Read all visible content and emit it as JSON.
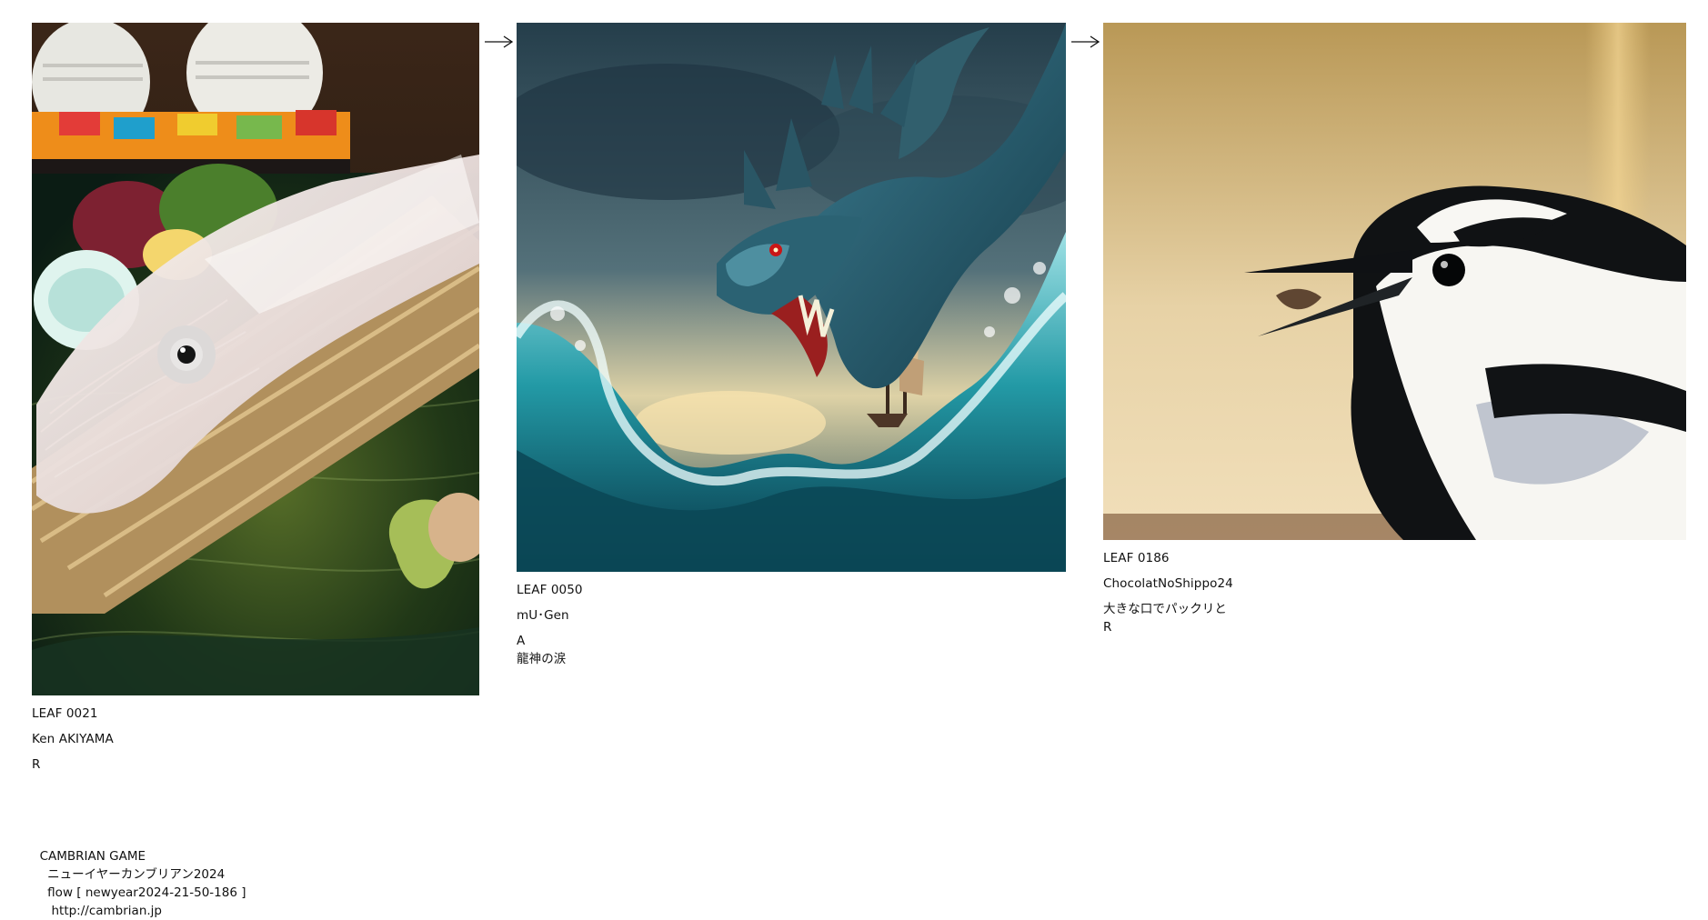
{
  "cards": [
    {
      "leaf": "LEAF 0021",
      "artist": "Ken AKIYAMA",
      "rank": "R",
      "title": "",
      "image_description": "Squid sashimi on a bamboo tray with soy sauce bottles, salt dish, seaweed and wasabi"
    },
    {
      "leaf": "LEAF 0050",
      "artist": "mU･Gen",
      "rank": "A",
      "title": "龍神の涙",
      "image_description": "Blue sea dragon rising from stormy ocean waves above a sailing ship"
    },
    {
      "leaf": "LEAF 0186",
      "artist": "ChocolatNoShippo24",
      "rank": "R",
      "title": "大きな口でパックリと",
      "image_description": "Black and white wagtail bird holding food in its beak"
    }
  ],
  "footer": {
    "site": "CAMBRIAN GAME",
    "event": "ニューイヤーカンブリアン2024",
    "flow": "flow [ newyear2024-21-50-186 ]",
    "url": "http://cambrian.jp"
  },
  "colors": {
    "text": "#111111",
    "background": "#ffffff"
  },
  "icons": {
    "arrow": "right-arrow-icon"
  }
}
